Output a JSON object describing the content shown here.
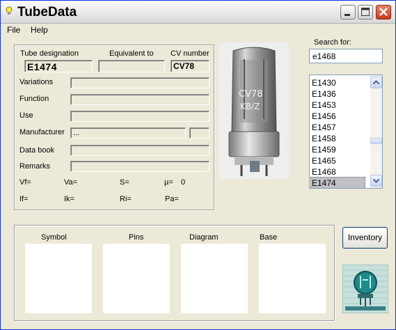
{
  "window": {
    "title": "TubeData"
  },
  "menu": {
    "file": "File",
    "help": "Help"
  },
  "details": {
    "tube_designation_label": "Tube designation",
    "tube_designation_value": "E1474",
    "equivalent_label": "Equivalent to",
    "equivalent_value": "",
    "cv_label": "CV number",
    "cv_value": "CV78",
    "variations_label": "Variations",
    "function_label": "Function",
    "use_label": "Use",
    "manufacturer_label": "Manufacturer",
    "manufacturer_value": "...",
    "databook_label": "Data book",
    "remarks_label": "Remarks",
    "params": {
      "vf": "Vf=",
      "va": "Va=",
      "s": "S=",
      "mu": "µ=",
      "mu_value": "0",
      "if": "If=",
      "ik": "Ik=",
      "ri": "Ri=",
      "pa": "Pa="
    }
  },
  "photo": {
    "marking_line1": "CV78",
    "marking_line2": "KB/Z"
  },
  "search": {
    "label": "Search for:",
    "value": "e1468",
    "results": [
      "E1430",
      "E1436",
      "E1453",
      "E1456",
      "E1457",
      "E1458",
      "E1459",
      "E1465",
      "E1468",
      "E1474"
    ],
    "selected": "E1474"
  },
  "bottom": {
    "symbol_label": "Symbol",
    "pins_label": "Pins",
    "diagram_label": "Diagram",
    "base_label": "Base",
    "inventory_button": "Inventory"
  },
  "colors": {
    "title_bar_close": "#c8391a",
    "selection": "#c0c0c8"
  }
}
